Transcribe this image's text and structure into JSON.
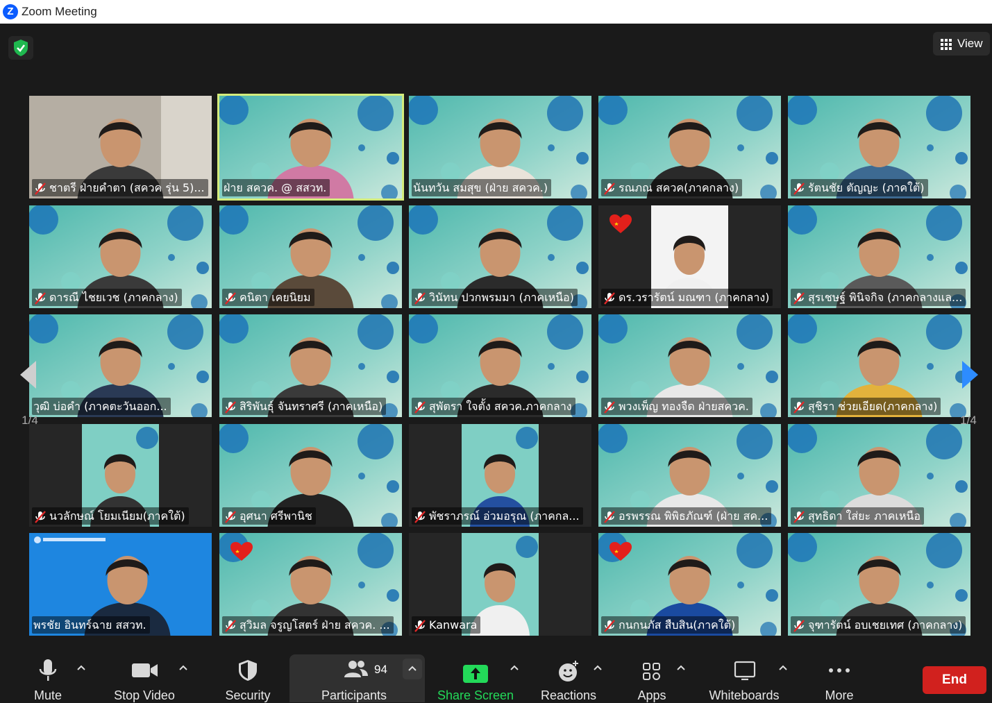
{
  "window": {
    "title": "Zoom Meeting"
  },
  "header": {
    "view_label": "View"
  },
  "pager": {
    "page_left": "1/4",
    "page_right": "1/4"
  },
  "tiles": [
    {
      "name": "ชาตรี ฝ่ายคำตา (สควค รุ่น 5)...",
      "muted": true,
      "style": "room"
    },
    {
      "name": "ฝ่าย สควค. @ สสวท.",
      "muted": false,
      "style": "bg",
      "active": true
    },
    {
      "name": "นันทวัน   สมสุข (ฝ่าย สควค.)",
      "muted": false,
      "style": "bg"
    },
    {
      "name": "รณภณ สควค(ภาคกลาง)",
      "muted": true,
      "style": "bg"
    },
    {
      "name": "รัตนชัย ตัญญะ (ภาคใต้)",
      "muted": true,
      "style": "bg"
    },
    {
      "name": "ดารณี ไชยเวช (ภาคกลาง)",
      "muted": true,
      "style": "bg"
    },
    {
      "name": "คนิตา เคยนิยม",
      "muted": true,
      "style": "bg"
    },
    {
      "name": "วินัทน ปวกพรมมา (ภาคเหนือ)",
      "muted": true,
      "style": "bg"
    },
    {
      "name": "ดร.วรารัตน์ มณฑา (ภาคกลาง)",
      "muted": true,
      "style": "narrow-white",
      "heart": true
    },
    {
      "name": "สุรเชษฐ์ พินิจกิจ (ภาคกลางแล...",
      "muted": true,
      "style": "bg"
    },
    {
      "name": "วุฒิ  บ่อคำ (ภาคตะวันออก...",
      "muted": false,
      "style": "bg"
    },
    {
      "name": "สิริพันธุ์ จันทราศรี (ภาคเหนือ)",
      "muted": true,
      "style": "bg"
    },
    {
      "name": "สุพัตรา  ใจตั้ง สควค.ภาคกลาง",
      "muted": true,
      "style": "bg"
    },
    {
      "name": "พวงเพ็ญ  ทองจืด ฝ่ายสควค.",
      "muted": true,
      "style": "bg"
    },
    {
      "name": "สุชิรา ช่วยเอียด(ภาคกลาง)",
      "muted": true,
      "style": "bg"
    },
    {
      "name": "นวลักษณ์ โยมเนียม(ภาคใต้)",
      "muted": true,
      "style": "narrow"
    },
    {
      "name": "อุศนา ศรีพานิช",
      "muted": true,
      "style": "bg"
    },
    {
      "name": "พัชราภรณ์ อ่วมอรุณ (ภาคกล...",
      "muted": true,
      "style": "narrow"
    },
    {
      "name": "อรพรรณ พิพิธภัณฑ์ (ฝ่าย สค...",
      "muted": true,
      "style": "bg"
    },
    {
      "name": "สุทธิดา ใส่ยะ ภาคเหนือ",
      "muted": true,
      "style": "bg"
    },
    {
      "name": "พรชัย อินทร์ฉาย สสวท.",
      "muted": false,
      "style": "blue"
    },
    {
      "name": "สุวิมล จรูญโสตร์ ฝ่าย สควค. ...",
      "muted": true,
      "style": "bg",
      "heart": true
    },
    {
      "name": "Kanwara",
      "muted": true,
      "style": "narrow"
    },
    {
      "name": "กนกนภัส สืบสิน(ภาคใต้)",
      "muted": true,
      "style": "bg",
      "heart": true
    },
    {
      "name": "จุฑารัตน์ อบเชยเทศ (ภาคกลาง)",
      "muted": true,
      "style": "bg"
    }
  ],
  "toolbar": {
    "mute_label": "Mute",
    "stop_video_label": "Stop Video",
    "security_label": "Security",
    "participants_label": "Participants",
    "participants_count": "94",
    "share_label": "Share Screen",
    "reactions_label": "Reactions",
    "apps_label": "Apps",
    "whiteboards_label": "Whiteboards",
    "more_label": "More",
    "end_label": "End"
  },
  "colors": {
    "accent_green": "#23d959",
    "end_red": "#d1211e",
    "active_outline": "#d4ec7c",
    "tile_teal": "#5fc1b4"
  }
}
